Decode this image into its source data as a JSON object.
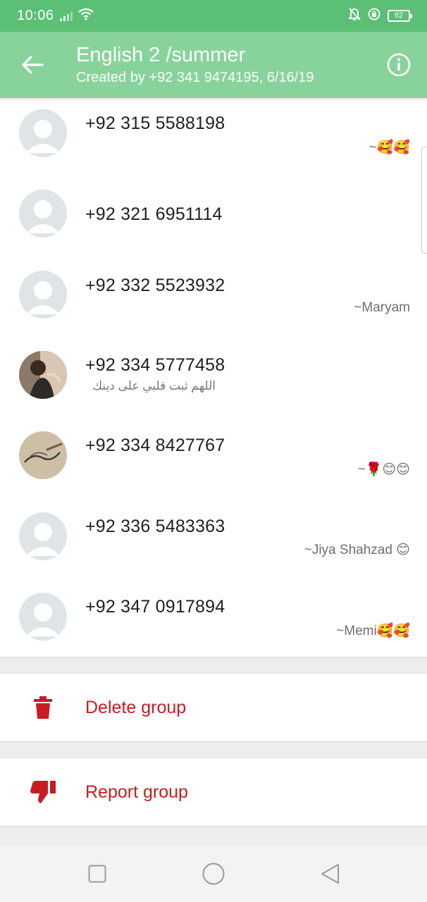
{
  "status_bar": {
    "time": "10:06",
    "battery": "62"
  },
  "header": {
    "title": "English 2 /summer",
    "subtitle": "Created by +92 341 9474195, 6/16/19"
  },
  "members": [
    {
      "phone": "+92 315 5588198",
      "status": "~🥰🥰",
      "about": "",
      "avatar": "default-avatar"
    },
    {
      "phone": "+92 321 6951114",
      "status": "",
      "about": "",
      "avatar": "default-avatar"
    },
    {
      "phone": "+92 332 5523932",
      "status": "~Maryam",
      "about": "",
      "avatar": "default-avatar"
    },
    {
      "phone": "+92 334 5777458",
      "status": "",
      "about": "اللهم ثبت قلبي على دينك",
      "avatar": "photo-avatar-girl"
    },
    {
      "phone": "+92 334 8427767",
      "status": "~🌹😊😊",
      "about": "",
      "avatar": "photo-avatar-calligraphy"
    },
    {
      "phone": "+92 336 5483363",
      "status": "~Jiya Shahzad 😊",
      "about": "",
      "avatar": "default-avatar"
    },
    {
      "phone": "+92 347 0917894",
      "status": "~Memi🥰🥰",
      "about": "",
      "avatar": "default-avatar"
    }
  ],
  "actions": {
    "delete_label": "Delete group",
    "report_label": "Report group"
  },
  "colors": {
    "status_bar": "#5cbf76",
    "app_bar": "#88d39c",
    "danger": "#c61d23",
    "avatar_bg": "#dfe5e7"
  }
}
